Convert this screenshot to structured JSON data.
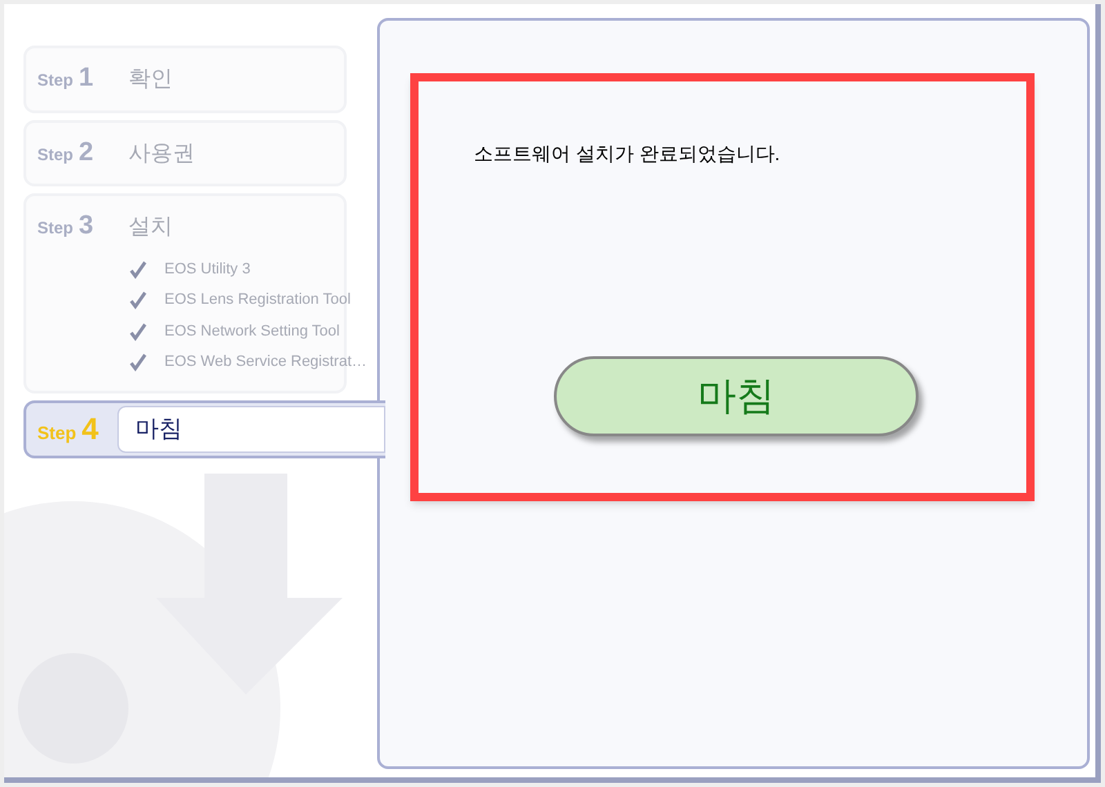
{
  "steps": [
    {
      "prefix": "Step",
      "number": "1",
      "title": "확인",
      "selected": false
    },
    {
      "prefix": "Step",
      "number": "2",
      "title": "사용권",
      "selected": false
    },
    {
      "prefix": "Step",
      "number": "3",
      "title": "설치",
      "selected": false,
      "items": [
        {
          "label": "EOS Utility 3",
          "checked": true
        },
        {
          "label": "EOS Lens Registration Tool",
          "checked": true
        },
        {
          "label": "EOS Network Setting Tool",
          "checked": true
        },
        {
          "label": "EOS Web Service Registrat…",
          "checked": true
        }
      ]
    },
    {
      "prefix": "Step",
      "number": "4",
      "title": "마침",
      "selected": true
    }
  ],
  "message": "소프트웨어 설치가 완료되었습니다.",
  "finish_button": "마침"
}
